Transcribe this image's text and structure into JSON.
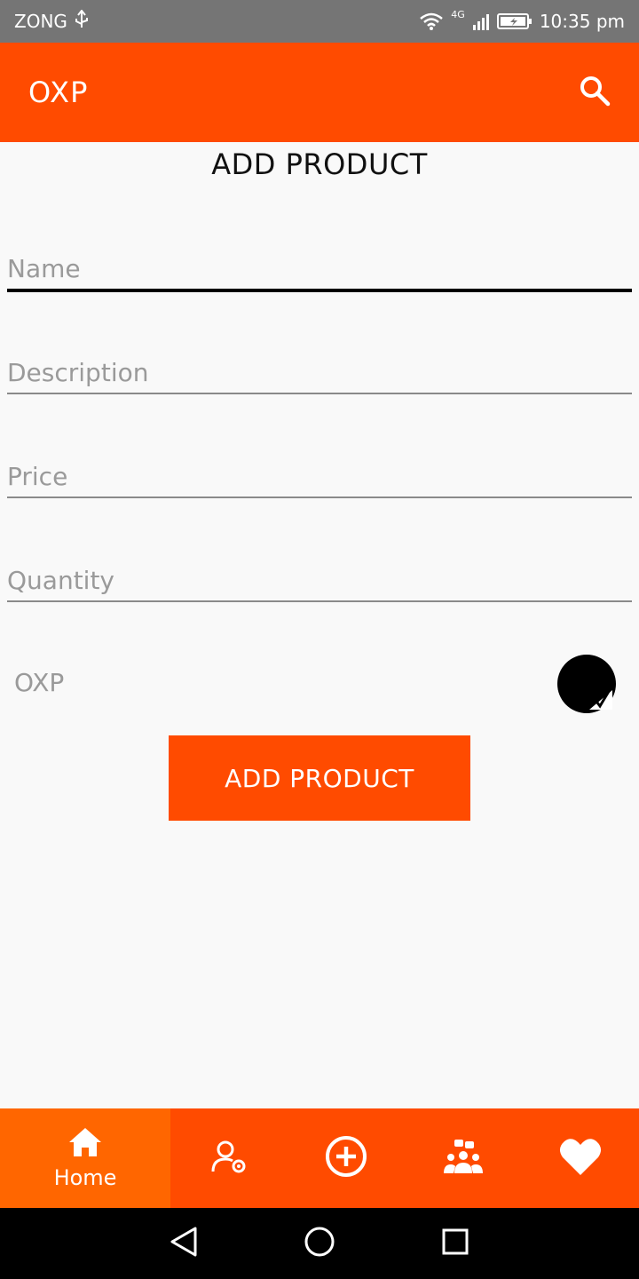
{
  "status_bar": {
    "carrier": "ZONG",
    "network": "4G",
    "time": "10:35 pm"
  },
  "app_bar": {
    "title": "OXP",
    "search_icon": "search-icon"
  },
  "page": {
    "heading": "ADD PRODUCT"
  },
  "form": {
    "name_placeholder": "Name",
    "description_placeholder": "Description",
    "price_placeholder": "Price",
    "quantity_placeholder": "Quantity",
    "brand_label": "OXP",
    "submit_label": "ADD PRODUCT"
  },
  "bottom_nav": {
    "items": [
      {
        "label": "Home",
        "icon": "home-icon",
        "active": true
      },
      {
        "label": "",
        "icon": "user-settings-icon",
        "active": false
      },
      {
        "label": "",
        "icon": "add-circle-icon",
        "active": false
      },
      {
        "label": "",
        "icon": "group-chat-icon",
        "active": false
      },
      {
        "label": "",
        "icon": "heart-icon",
        "active": false
      }
    ]
  },
  "colors": {
    "primary": "#ff4b00",
    "active_tab": "#ff6600",
    "status_bar": "#757575"
  }
}
